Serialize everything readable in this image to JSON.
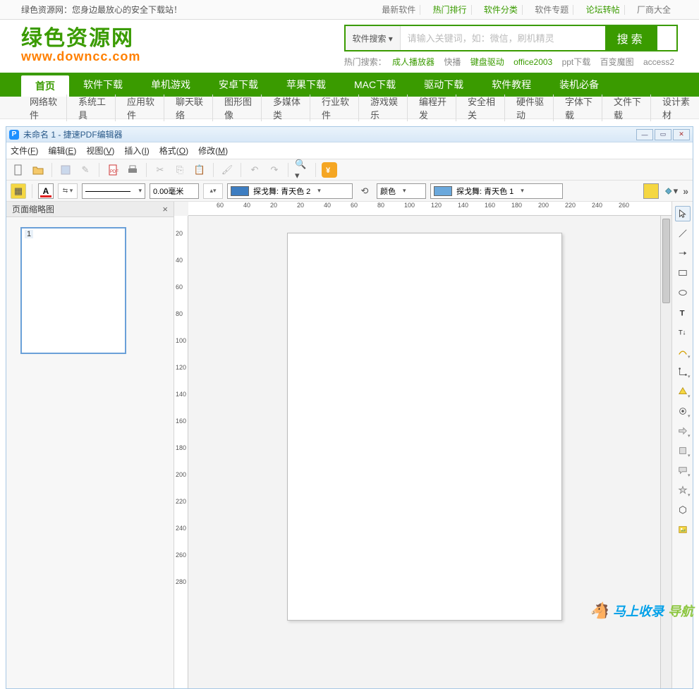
{
  "topbar": {
    "tagline": "绿色资源网：您身边最放心的安全下载站！",
    "links": [
      {
        "label": "最新软件",
        "green": false
      },
      {
        "label": "热门排行",
        "green": true
      },
      {
        "label": "软件分类",
        "green": true
      },
      {
        "label": "软件专题",
        "green": false
      },
      {
        "label": "论坛转帖",
        "green": true
      },
      {
        "label": "厂商大全",
        "green": false
      }
    ]
  },
  "logo": {
    "cn": "绿色资源网",
    "en": "www.downcc.com"
  },
  "search": {
    "type": "软件搜索 ▾",
    "placeholder": "请输入关键词，如：微信，刷机精灵",
    "button": "搜索",
    "hot_label": "热门搜索：",
    "hot_links": [
      {
        "label": "成人播放器",
        "green": true
      },
      {
        "label": "快播",
        "green": false
      },
      {
        "label": "键盘驱动",
        "green": true
      },
      {
        "label": "office2003",
        "green": true
      },
      {
        "label": "ppt下载",
        "green": false
      },
      {
        "label": "百变魔图",
        "green": false
      },
      {
        "label": "access2",
        "green": false
      }
    ]
  },
  "nav": [
    {
      "label": "首页",
      "active": true
    },
    {
      "label": "软件下载"
    },
    {
      "label": "单机游戏"
    },
    {
      "label": "安卓下载"
    },
    {
      "label": "苹果下载"
    },
    {
      "label": "MAC下载"
    },
    {
      "label": "驱动下载"
    },
    {
      "label": "软件教程"
    },
    {
      "label": "装机必备"
    }
  ],
  "subnav": [
    "网络软件",
    "系统工具",
    "应用软件",
    "聊天联络",
    "图形图像",
    "多媒体类",
    "行业软件",
    "游戏娱乐",
    "编程开发",
    "安全相关",
    "硬件驱动",
    "字体下载",
    "文件下载",
    "设计素材"
  ],
  "pdf": {
    "title": "未命名 1 - 捷速PDF编辑器",
    "menus": [
      {
        "label": "文件",
        "key": "F"
      },
      {
        "label": "编辑",
        "key": "E"
      },
      {
        "label": "视图",
        "key": "V"
      },
      {
        "label": "插入",
        "key": "I"
      },
      {
        "label": "格式",
        "key": "O"
      },
      {
        "label": "修改",
        "key": "M"
      }
    ],
    "thumb_title": "页面缩略图",
    "thumb_page": "1",
    "size_value": "0.00毫米",
    "color_label": "颜色",
    "color_combo1": "探戈舞: 青天色 2",
    "color_combo2": "探戈舞: 青天色 1",
    "hruler_ticks": [
      -60,
      -40,
      -20,
      20,
      40,
      60,
      80,
      100,
      120,
      140,
      160,
      180,
      200,
      220,
      240,
      260
    ],
    "vruler_ticks": [
      20,
      40,
      60,
      80,
      100,
      120,
      140,
      160,
      180,
      200,
      220,
      240,
      260,
      280
    ]
  },
  "watermark": {
    "icon": "🐴",
    "t1": "马上收录",
    "t2": "导航"
  }
}
